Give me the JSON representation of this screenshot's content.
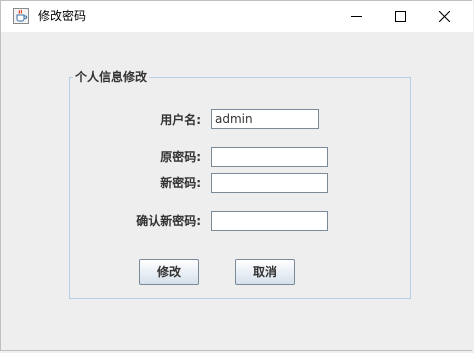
{
  "window": {
    "title": "修改密码",
    "app_icon": "java-cup-icon",
    "controls": {
      "minimize": "minimize-icon",
      "maximize": "maximize-icon",
      "close": "close-icon"
    }
  },
  "form": {
    "group_title": "个人信息修改",
    "username_label": "用户名:",
    "username_value": "admin",
    "old_password_label": "原密码:",
    "old_password_value": "",
    "new_password_label": "新密码:",
    "new_password_value": "",
    "confirm_password_label": "确认新密码:",
    "confirm_password_value": ""
  },
  "buttons": {
    "edit_label": "修改",
    "cancel_label": "取消"
  },
  "colors": {
    "titlebar_bg": "#ffffff",
    "content_bg": "#eeeeee",
    "group_border": "#b8cfe5",
    "button_gradient_top": "#ffffff",
    "button_gradient_bottom": "#d6e0eb"
  }
}
